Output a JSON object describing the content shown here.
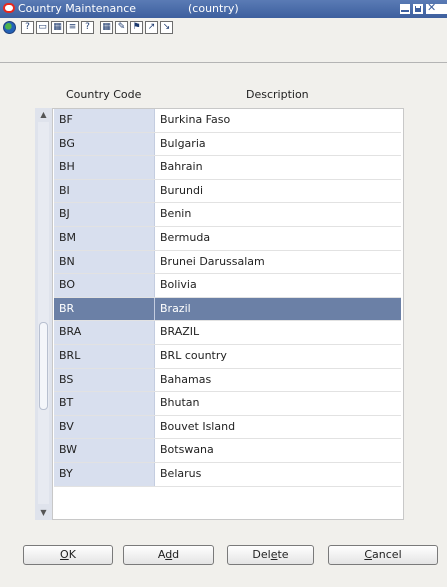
{
  "window": {
    "title": "Country Maintenance",
    "subtitle": "(country)"
  },
  "toolbar": {
    "icons": [
      "globe-icon",
      "help-icon",
      "print-icon",
      "table-icon",
      "attach-icon",
      "info-icon",
      "grid-icon",
      "edit-icon",
      "flag-icon",
      "export-icon",
      "import-icon"
    ]
  },
  "grid": {
    "columns": [
      "Country Code",
      "Description"
    ],
    "rows": [
      {
        "code": "BF",
        "desc": "Burkina Faso"
      },
      {
        "code": "BG",
        "desc": "Bulgaria"
      },
      {
        "code": "BH",
        "desc": "Bahrain"
      },
      {
        "code": "BI",
        "desc": "Burundi"
      },
      {
        "code": "BJ",
        "desc": "Benin"
      },
      {
        "code": "BM",
        "desc": "Bermuda"
      },
      {
        "code": "BN",
        "desc": "Brunei Darussalam"
      },
      {
        "code": "BO",
        "desc": "Bolivia"
      },
      {
        "code": "BR",
        "desc": "Brazil"
      },
      {
        "code": "BRA",
        "desc": "BRAZIL"
      },
      {
        "code": "BRL",
        "desc": "BRL country"
      },
      {
        "code": "BS",
        "desc": "Bahamas"
      },
      {
        "code": "BT",
        "desc": "Bhutan"
      },
      {
        "code": "BV",
        "desc": "Bouvet Island"
      },
      {
        "code": "BW",
        "desc": "Botswana"
      },
      {
        "code": "BY",
        "desc": "Belarus"
      }
    ],
    "selected_code": "BR"
  },
  "buttons": {
    "ok_mnemonic": "O",
    "ok_rest": "K",
    "add_pre": "A",
    "add_mnemonic": "d",
    "add_rest": "d",
    "delete_pre": "Del",
    "delete_mnemonic": "e",
    "delete_rest": "te",
    "cancel_mnemonic": "C",
    "cancel_rest": "ancel"
  },
  "colors": {
    "titlebar": "#3d5f9e",
    "selected_row": "#6b80a6",
    "code_column": "#d8dfee"
  }
}
